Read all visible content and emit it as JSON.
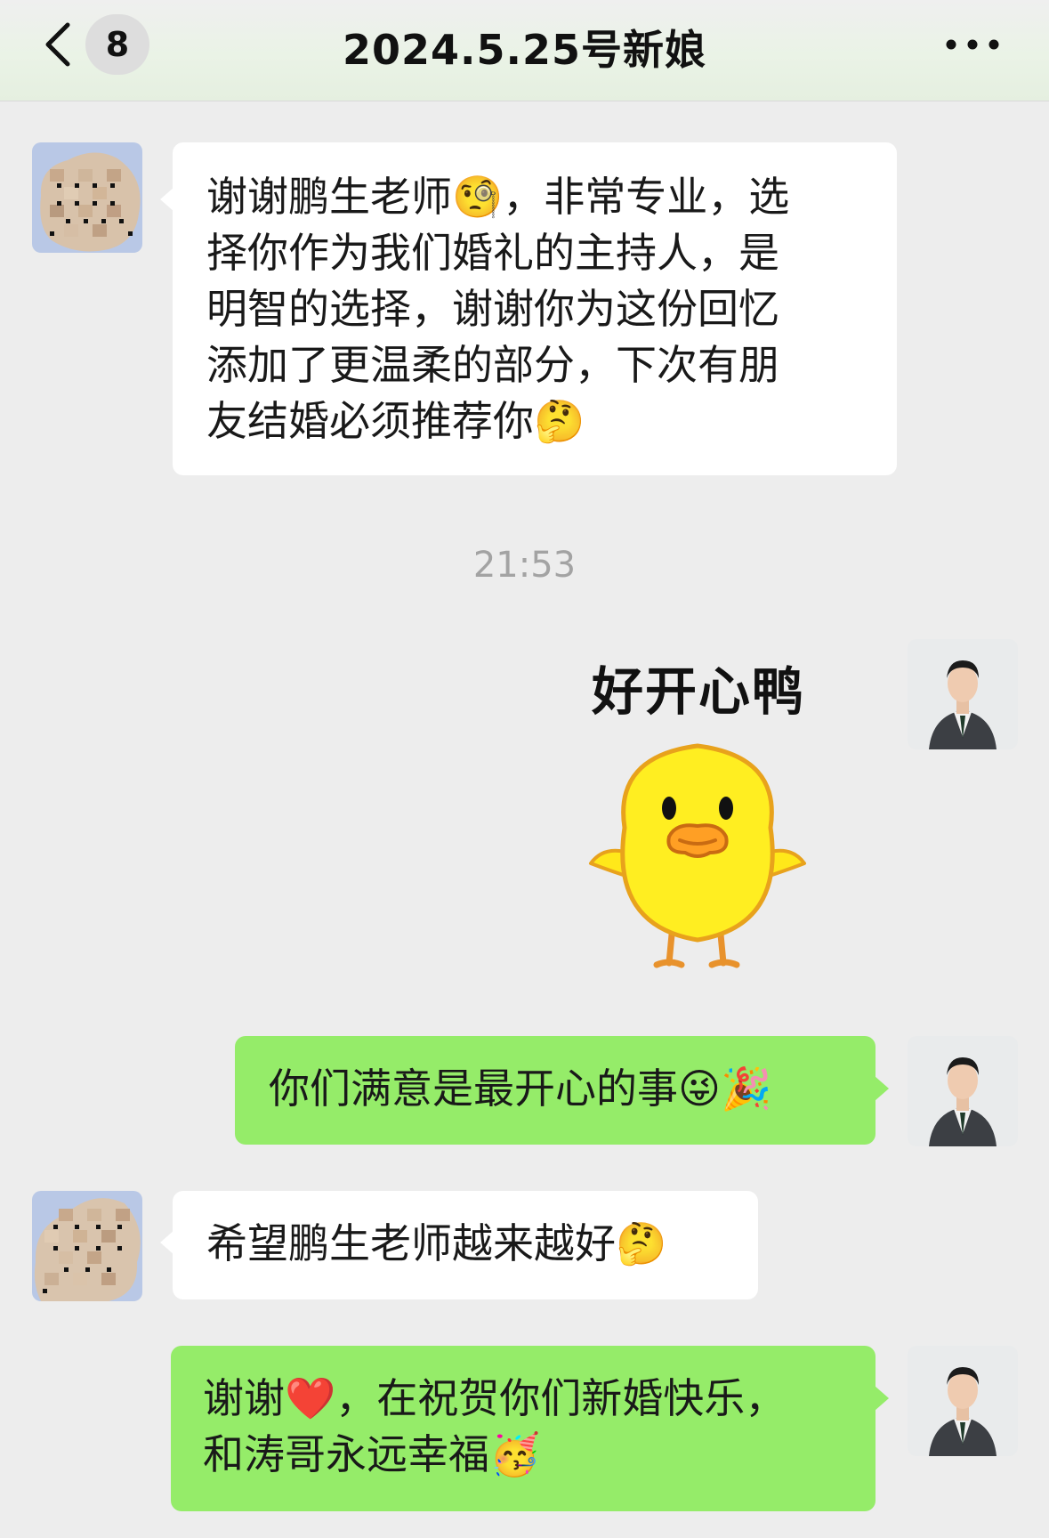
{
  "header": {
    "back_label": "back",
    "unread_count": "8",
    "title": "2024.5.25号新娘",
    "more_label": "more"
  },
  "messages": [
    {
      "from": "bride",
      "lines": [
        "谢谢鹏生老师🧐，非常专业，选",
        "择你作为我们婚礼的主持人，是",
        "明智的选择，谢谢你为这份回忆",
        "添加了更温柔的部分，下次有朋",
        "友结婚必须推荐你🤔"
      ]
    },
    {
      "type": "timestamp",
      "text": "21:53"
    },
    {
      "from": "host",
      "type": "sticker",
      "caption": "好开心鸭",
      "sticker_subject": "yellow duckling"
    },
    {
      "from": "host",
      "lines": [
        "你们满意是最开心的事😜🎉"
      ]
    },
    {
      "from": "bride",
      "lines": [
        "希望鹏生老师越来越好🤔"
      ]
    },
    {
      "from": "host",
      "lines": [
        "谢谢❤️，在祝贺你们新婚快乐，",
        "和涛哥永远幸福🥳"
      ]
    }
  ],
  "icons": {
    "back": "chevron-left-icon",
    "more": "more-dots-icon",
    "bride_avatar": "mosaic-avatar",
    "host_avatar": "suit-man-avatar"
  },
  "colors": {
    "background": "#ededed",
    "incoming_bubble": "#ffffff",
    "outgoing_bubble": "#95ec69",
    "timestamp": "#a3a3a3"
  }
}
